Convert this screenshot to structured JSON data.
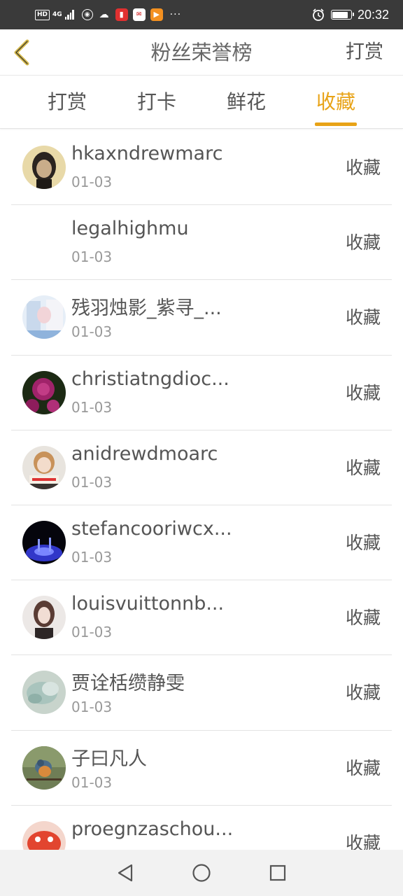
{
  "status_bar": {
    "hd": "HD",
    "network": "4G",
    "time": "20:32",
    "battery_level": 0.85,
    "app_icons": [
      "huawei-video-icon",
      "reader-icon",
      "huawei-mail-icon",
      "video-play-icon"
    ]
  },
  "header": {
    "title": "粉丝荣誉榜",
    "action": "打赏"
  },
  "tabs": [
    {
      "label": "打赏",
      "active": false
    },
    {
      "label": "打卡",
      "active": false
    },
    {
      "label": "鲜花",
      "active": false
    },
    {
      "label": "收藏",
      "active": true
    }
  ],
  "colors": {
    "accent": "#e8a317",
    "back_arrow": "#d4b84a",
    "text": "#555555",
    "muted": "#999999"
  },
  "rows": [
    {
      "name": "hkaxndrewmarc",
      "date": "01-03",
      "action": "收藏",
      "avatar": "portrait-woman-dark-hair"
    },
    {
      "name": "legalhighmu",
      "date": "01-03",
      "action": "收藏",
      "avatar": "none"
    },
    {
      "name": "残羽烛影_紫寻_...",
      "date": "01-03",
      "action": "收藏",
      "avatar": "anime-pastel"
    },
    {
      "name": "christiatngdioc...",
      "date": "01-03",
      "action": "收藏",
      "avatar": "pink-rose"
    },
    {
      "name": "anidrewdmoarc",
      "date": "01-03",
      "action": "收藏",
      "avatar": "girl-cartoon"
    },
    {
      "name": "stefancooriwcx...",
      "date": "01-03",
      "action": "收藏",
      "avatar": "blue-light-night"
    },
    {
      "name": "louisvuittonnb...",
      "date": "01-03",
      "action": "收藏",
      "avatar": "portrait-woman-pale"
    },
    {
      "name": "贾诠栝缵静雯",
      "date": "01-03",
      "action": "收藏",
      "avatar": "jade-carving"
    },
    {
      "name": "子曰凡人",
      "date": "01-03",
      "action": "收藏",
      "avatar": "bird-branch"
    },
    {
      "name": "proegnzaschou...",
      "date": "",
      "action": "收藏",
      "avatar": "red-cartoon"
    }
  ],
  "nav": [
    "back-triangle-icon",
    "home-circle-icon",
    "recents-square-icon"
  ]
}
